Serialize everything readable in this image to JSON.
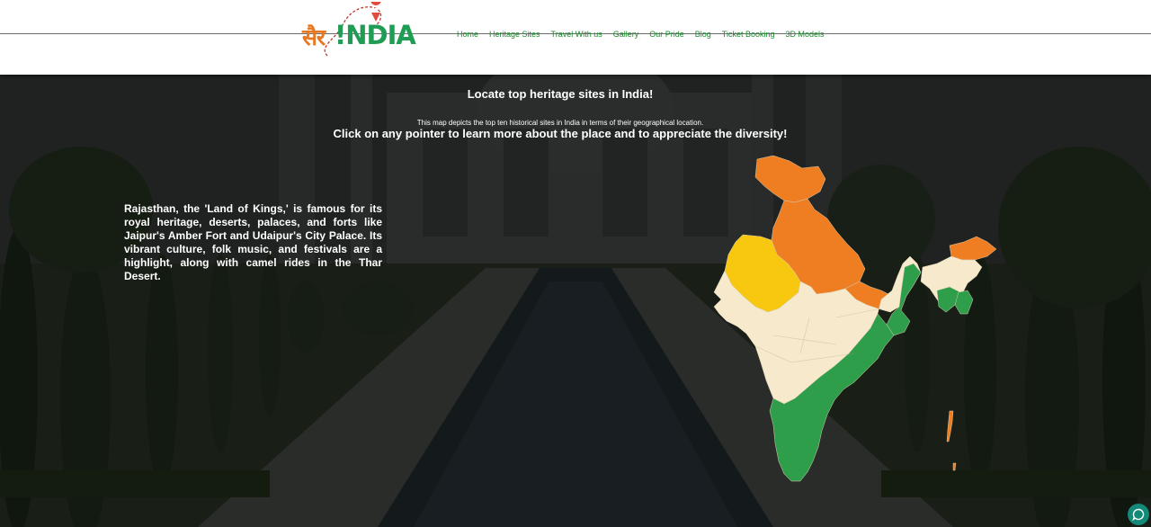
{
  "brand": {
    "hindi": "सैर",
    "latin": "!NDIA",
    "alt": "सैर INDIA"
  },
  "nav": {
    "items": [
      {
        "label": "Home"
      },
      {
        "label": "Heritage Sites"
      },
      {
        "label": "Travel With us"
      },
      {
        "label": "Gallery"
      },
      {
        "label": "Our Pride"
      },
      {
        "label": "Blog"
      },
      {
        "label": "Ticket Booking"
      },
      {
        "label": "3D Models"
      }
    ]
  },
  "hero": {
    "title": "Locate top heritage sites in India!",
    "subtitle": "This map depicts the top ten historical sites in India in terms of their geographical location.",
    "cta": "Click on any pointer to learn more about the place and to appreciate the diversity!"
  },
  "info": {
    "text": "Rajasthan, the 'Land of Kings,' is famous for its royal heritage, deserts, palaces, and forts like Jaipur's Amber Fort and Udaipur's City Palace. Its vibrant culture, folk music, and festivals are a highlight, along with camel rides in the Thar Desert."
  },
  "map": {
    "colors": {
      "north": "#ef7d22",
      "central": "#f6e9cc",
      "south": "#2f9e4b",
      "highlight": "#f8c70f"
    },
    "selected_state": "Rajasthan"
  },
  "chat": {
    "icon": "chat-bubble-icon"
  }
}
